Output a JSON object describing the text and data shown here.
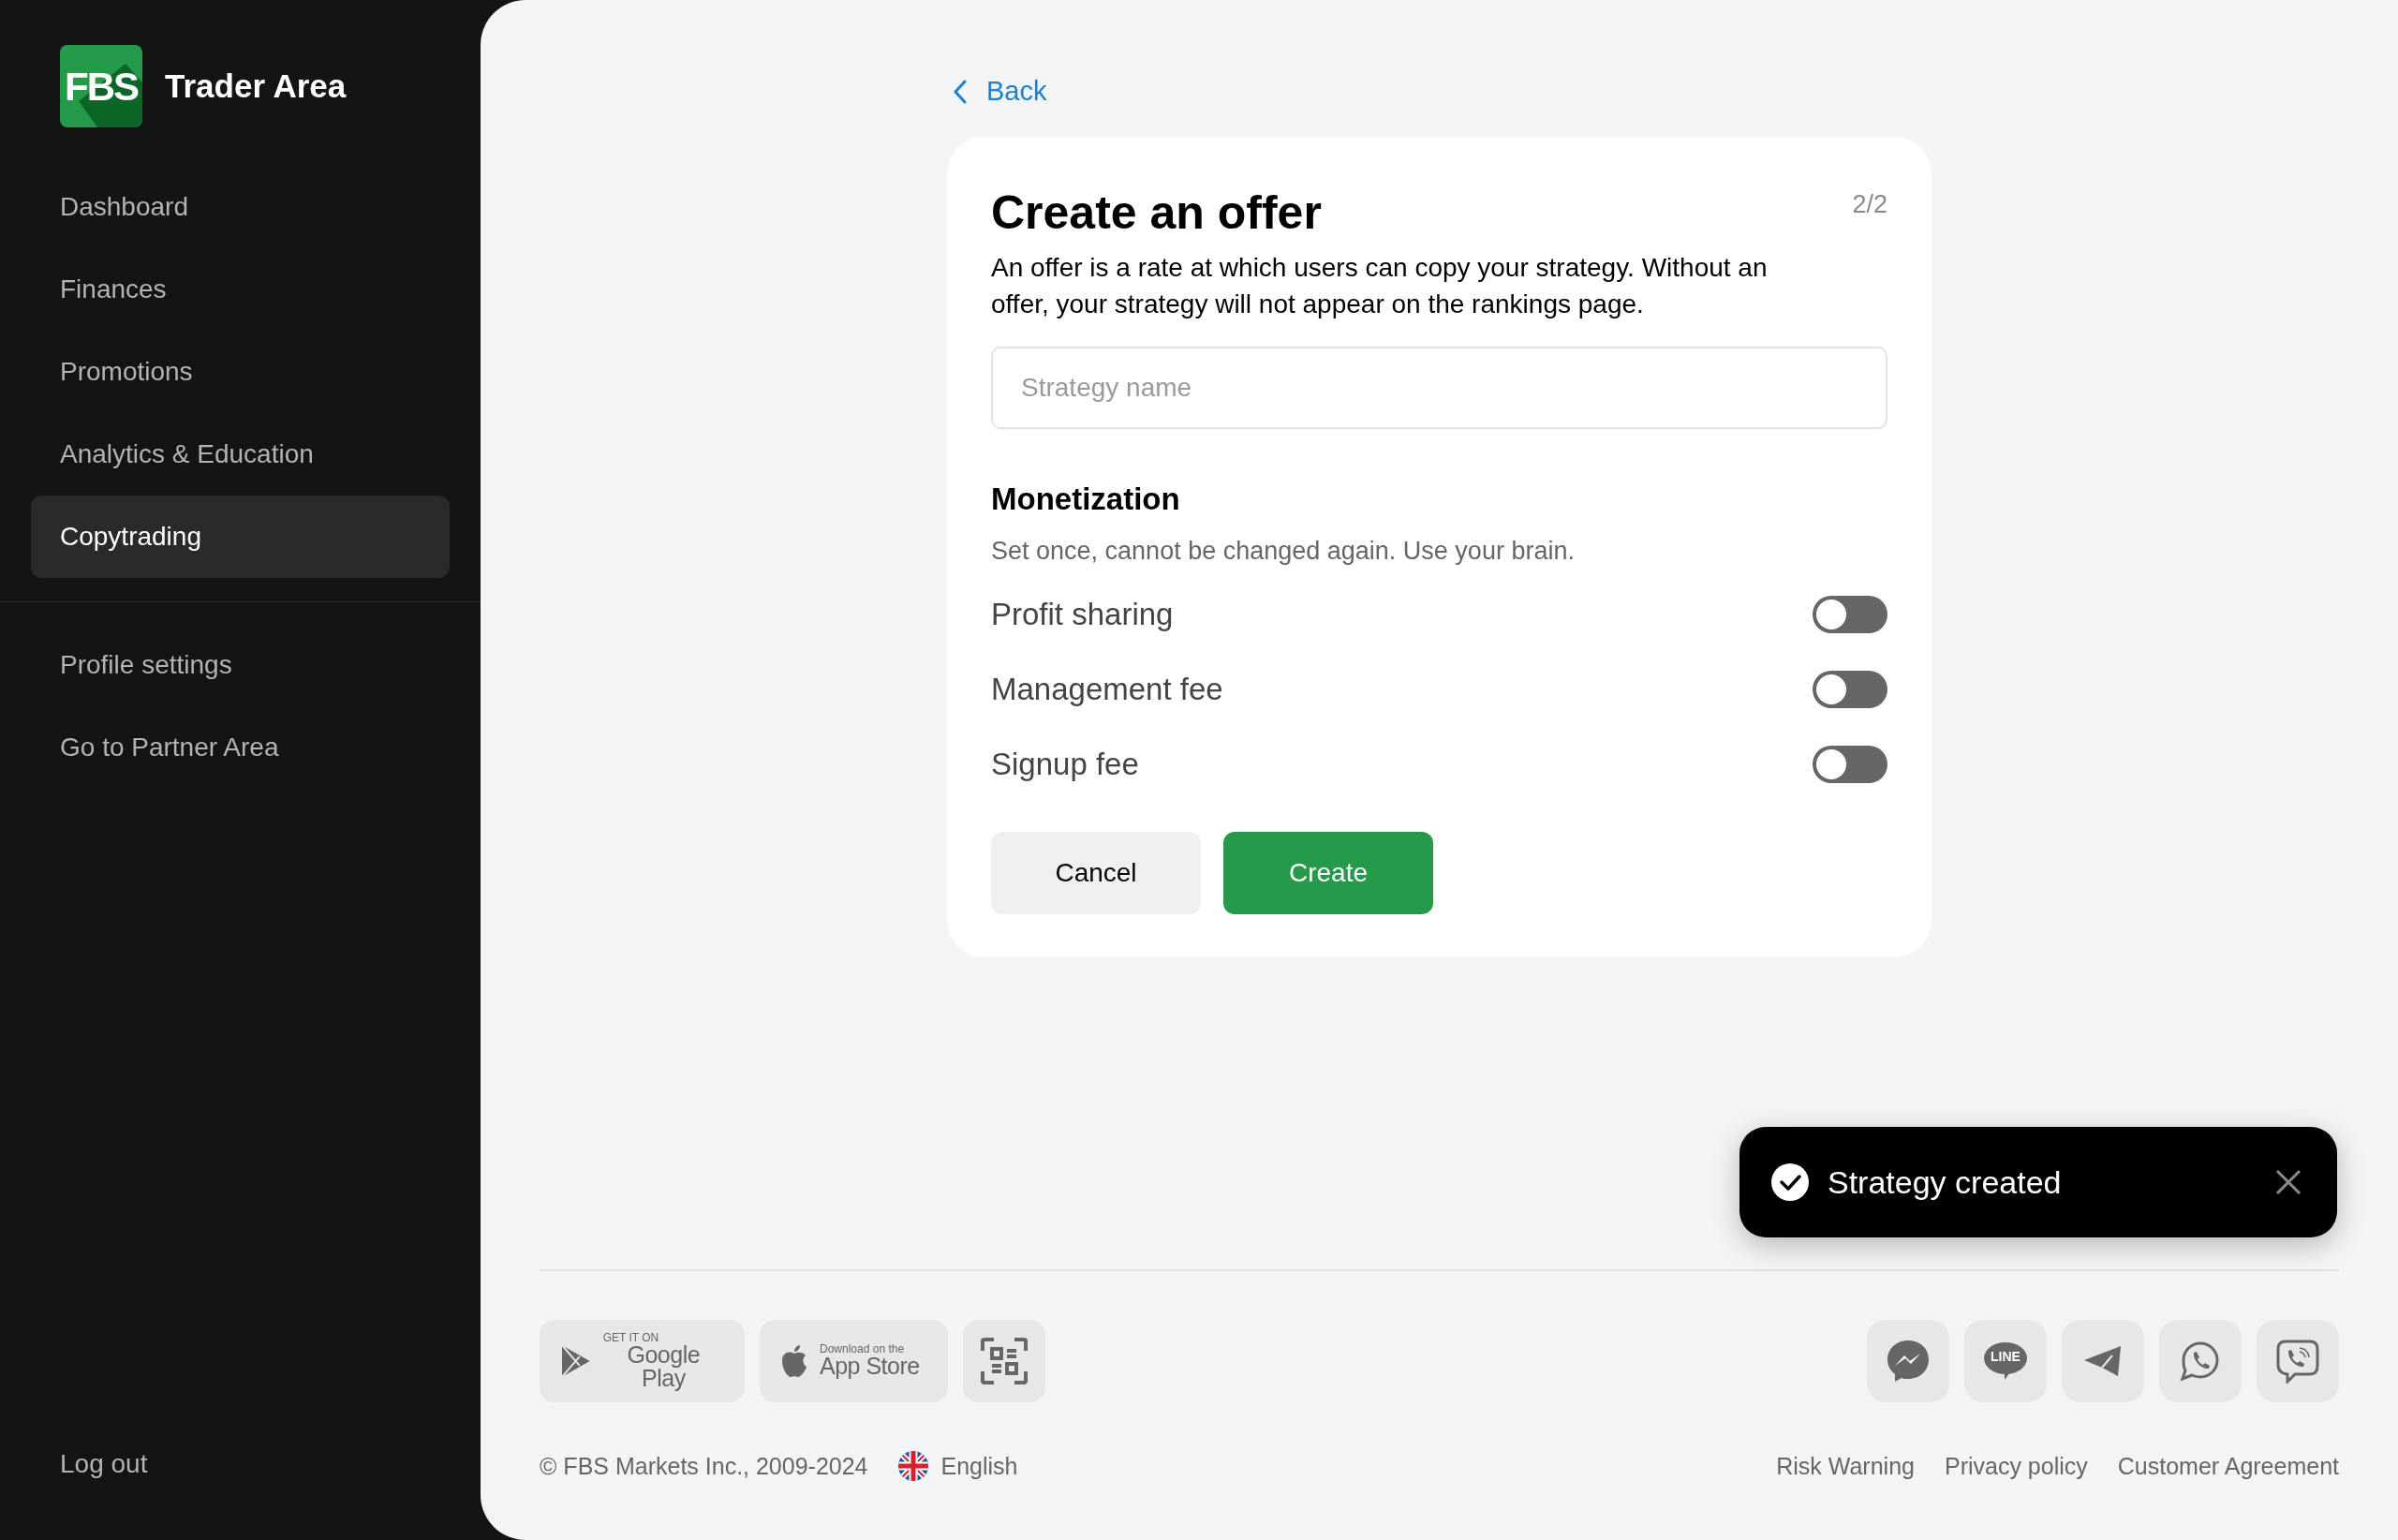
{
  "sidebar": {
    "logo": {
      "mark": "FBS",
      "title": "Trader Area"
    },
    "nav": [
      {
        "label": "Dashboard",
        "selected": false
      },
      {
        "label": "Finances",
        "selected": false
      },
      {
        "label": "Promotions",
        "selected": false
      },
      {
        "label": "Analytics & Education",
        "selected": false
      },
      {
        "label": "Copytrading",
        "selected": true
      }
    ],
    "secondary_nav": [
      "Profile settings",
      "Go to Partner Area"
    ],
    "logout": "Log out"
  },
  "back_link": "Back",
  "offer_card": {
    "title": "Create an offer",
    "step": "2/2",
    "description": "An offer is a rate at which users can copy your strategy. Without an offer, your strategy will not appear on the rankings page.",
    "strategy_name": {
      "placeholder": "Strategy name"
    },
    "monetization": {
      "heading": "Monetization",
      "note": "Set once, cannot be changed again. Use your brain.",
      "options": [
        {
          "label": "Profit sharing",
          "on": false
        },
        {
          "label": "Management fee",
          "on": false
        },
        {
          "label": "Signup fee",
          "on": false
        }
      ]
    },
    "buttons": [
      {
        "label": "Cancel",
        "kind": "secondary"
      },
      {
        "label": "Create",
        "kind": "primary"
      }
    ]
  },
  "toast": {
    "message": "Strategy created"
  },
  "footer": {
    "app_badges": [
      {
        "kind": "google_play",
        "small": "GET IT ON",
        "large": "Google Play"
      },
      {
        "kind": "app_store",
        "small": "Download on the",
        "large": "App Store"
      },
      {
        "kind": "qr"
      }
    ],
    "messengers": [
      {
        "kind": "messenger"
      },
      {
        "kind": "line",
        "label": "LINE"
      },
      {
        "kind": "telegram"
      },
      {
        "kind": "whatsapp"
      },
      {
        "kind": "viber"
      }
    ],
    "copyright": "© FBS Markets Inc., 2009-2024",
    "language": "English",
    "links": [
      "Risk Warning",
      "Privacy policy",
      "Customer Agreement"
    ]
  }
}
